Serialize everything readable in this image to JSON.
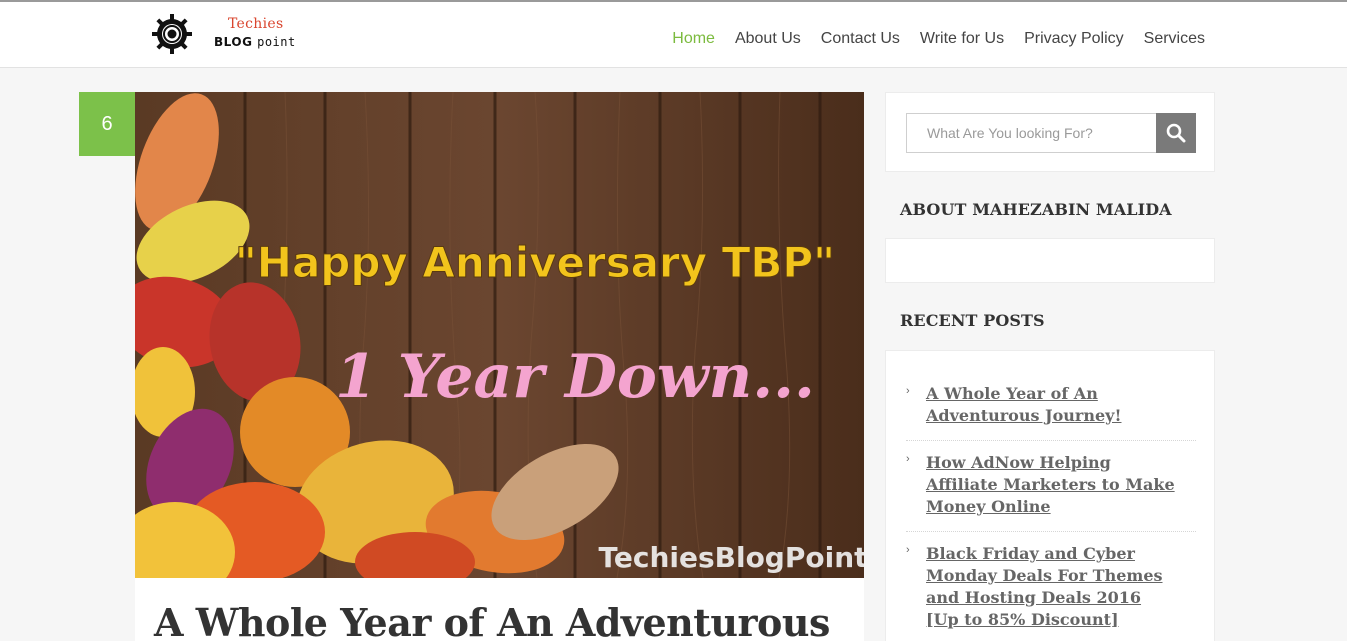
{
  "brand": {
    "logo_top": "Techies",
    "logo_bottom_bold": "BLOG",
    "logo_bottom_light": "point"
  },
  "nav": {
    "items": [
      {
        "label": "Home",
        "active": true
      },
      {
        "label": "About Us",
        "active": false
      },
      {
        "label": "Contact Us",
        "active": false
      },
      {
        "label": "Write for Us",
        "active": false
      },
      {
        "label": "Privacy Policy",
        "active": false
      },
      {
        "label": "Services",
        "active": false
      }
    ]
  },
  "colors": {
    "accent_green": "#7cc14a",
    "nav_active": "#7cbb3f",
    "search_button": "#7a7a7a",
    "banner_title_yellow": "#f2c41c",
    "banner_subtitle_pink": "#f4a4cf"
  },
  "post": {
    "number": "6",
    "image": {
      "headline": "\"Happy Anniversary TBP\"",
      "subline": "1 Year Down...",
      "watermark": "TechiesBlogPoint"
    },
    "title": "A Whole Year of An Adventurous"
  },
  "sidebar": {
    "search": {
      "placeholder": "What Are You looking For?",
      "button_icon": "search-icon"
    },
    "about_heading": "ABOUT MAHEZABIN MALIDA",
    "recent_heading": "RECENT POSTS",
    "recent_posts": [
      "A Whole Year of An Adventurous Journey!",
      "How AdNow Helping Affiliate Marketers to Make Money Online",
      "Black Friday and Cyber Monday Deals For Themes and Hosting Deals 2016 [Up to 85% Discount]"
    ]
  }
}
